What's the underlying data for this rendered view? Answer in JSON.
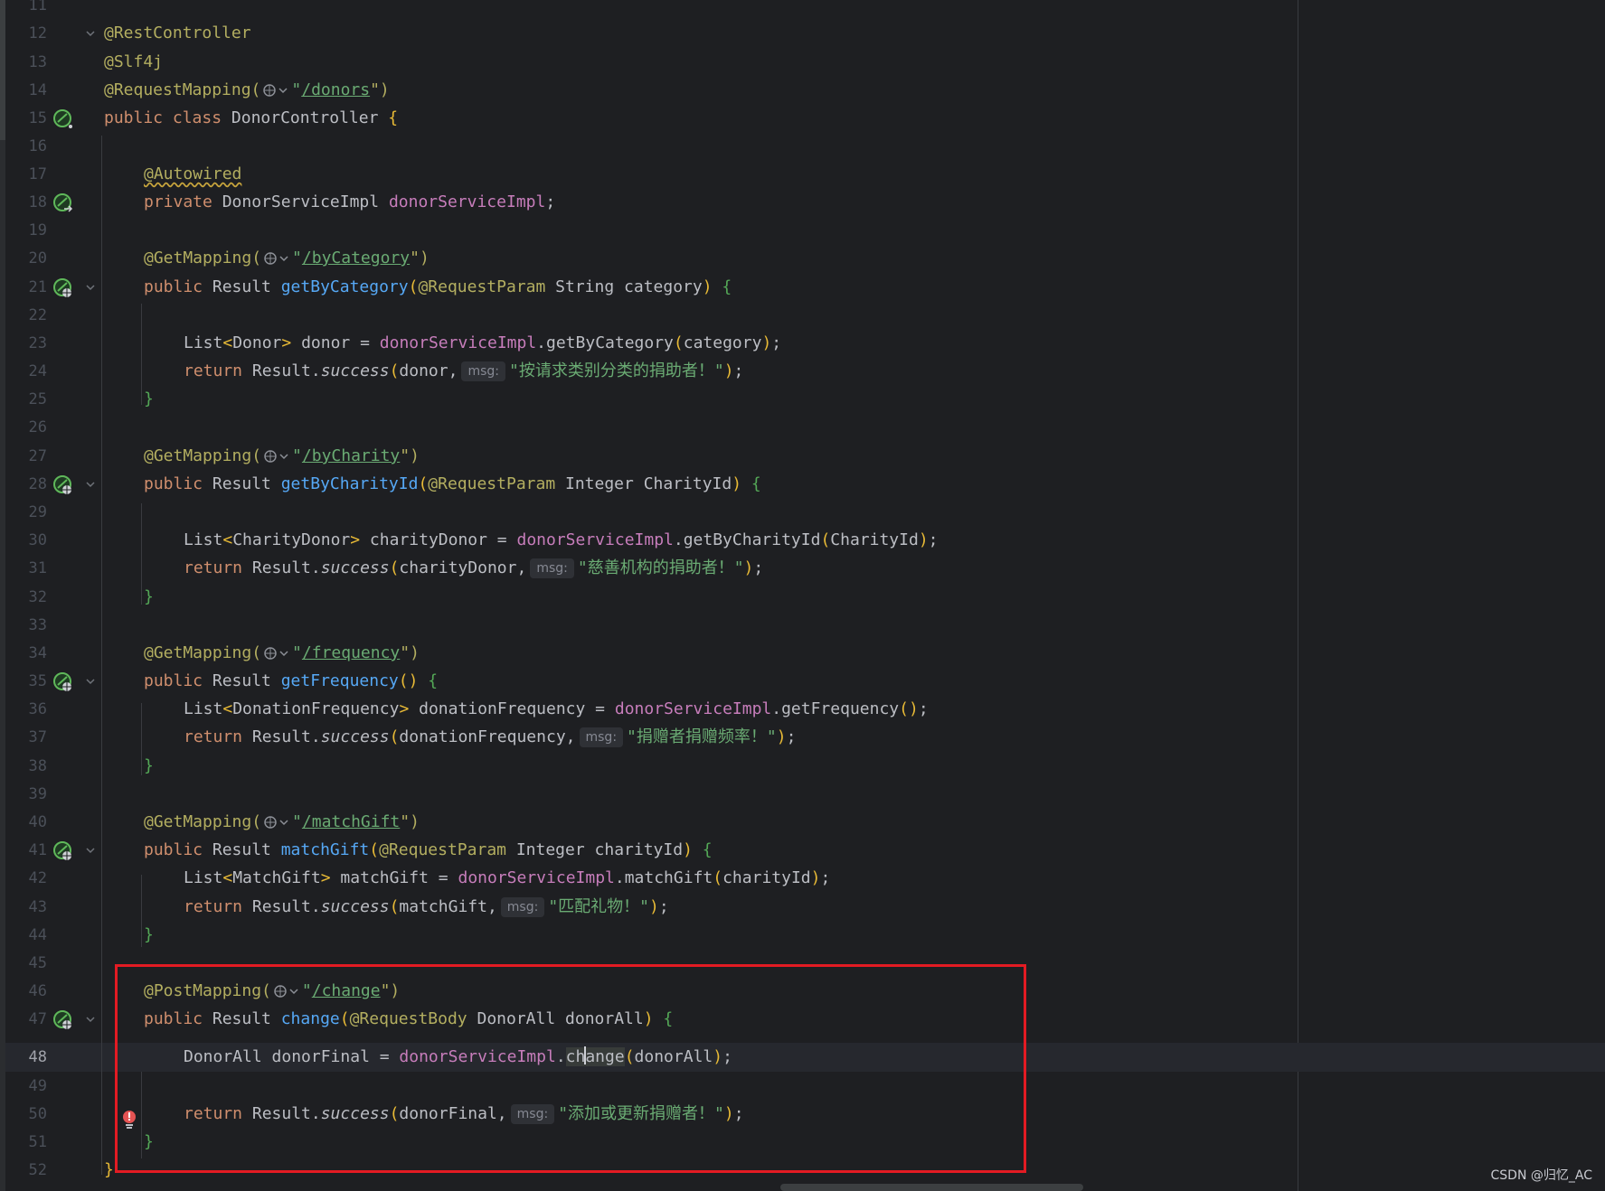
{
  "editor": {
    "language": "java",
    "current_line": 48,
    "lines": [
      {
        "n": "11"
      },
      {
        "n": "12",
        "code": {
          "t1": "@RestController"
        }
      },
      {
        "n": "13",
        "code": {
          "t1": "@Slf4j"
        }
      },
      {
        "n": "14",
        "code": {
          "t1": "@RequestMapping(",
          "url": "/donors",
          "t2": "\")"
        }
      },
      {
        "n": "15",
        "code": {
          "kw": "public class ",
          "t1": "DonorController ",
          "b": "{"
        }
      },
      {
        "n": "16"
      },
      {
        "n": "17",
        "code": {
          "t1": "@Autowired"
        }
      },
      {
        "n": "18",
        "code": {
          "kw": "private ",
          "t1": "DonorServiceImpl ",
          "fld": "donorServiceImpl",
          "t2": ";"
        }
      },
      {
        "n": "19"
      },
      {
        "n": "20",
        "code": {
          "t1": "@GetMapping(",
          "url": "/byCategory",
          "t2": "\")"
        }
      },
      {
        "n": "21",
        "code": {
          "kw": "public ",
          "t1": "Result ",
          "fn": "getByCategory",
          "p": "(",
          "an": "@RequestParam ",
          "t2": "String category",
          "p2": ") ",
          "b": "{"
        }
      },
      {
        "n": "22"
      },
      {
        "n": "23",
        "code": {
          "t1": "List",
          "lt": "<",
          "t2": "Donor",
          "gt": ">",
          "t3": " donor = ",
          "fld": "donorServiceImpl",
          "t4": ".getByCategory",
          "p": "(",
          "t5": "category",
          "p2": ")",
          "t6": ";"
        }
      },
      {
        "n": "24",
        "code": {
          "kw": "return ",
          "t1": "Result.",
          "it": "success",
          "p": "(",
          "t2": "donor,",
          "hint": "msg:",
          "str": "\"按请求类别分类的捐助者！\"",
          "p2": ")",
          "t3": ";"
        }
      },
      {
        "n": "25",
        "code": {
          "b": "}"
        }
      },
      {
        "n": "26"
      },
      {
        "n": "27",
        "code": {
          "t1": "@GetMapping(",
          "url": "/byCharity",
          "t2": "\")"
        }
      },
      {
        "n": "28",
        "code": {
          "kw": "public ",
          "t1": "Result ",
          "fn": "getByCharityId",
          "p": "(",
          "an": "@RequestParam ",
          "t2": "Integer CharityId",
          "p2": ") ",
          "b": "{"
        }
      },
      {
        "n": "29"
      },
      {
        "n": "30",
        "code": {
          "t1": "List",
          "lt": "<",
          "t2": "CharityDonor",
          "gt": ">",
          "t3": " charityDonor = ",
          "fld": "donorServiceImpl",
          "t4": ".getByCharityId",
          "p": "(",
          "t5": "CharityId",
          "p2": ")",
          "t6": ";"
        }
      },
      {
        "n": "31",
        "code": {
          "kw": "return ",
          "t1": "Result.",
          "it": "success",
          "p": "(",
          "t2": "charityDonor,",
          "hint": "msg:",
          "str": "\"慈善机构的捐助者！\"",
          "p2": ")",
          "t3": ";"
        }
      },
      {
        "n": "32",
        "code": {
          "b": "}"
        }
      },
      {
        "n": "33"
      },
      {
        "n": "34",
        "code": {
          "t1": "@GetMapping(",
          "url": "/frequency",
          "t2": "\")"
        }
      },
      {
        "n": "35",
        "code": {
          "kw": "public ",
          "t1": "Result ",
          "fn": "getFrequency",
          "p": "()",
          "t2": " ",
          "b": "{"
        }
      },
      {
        "n": "36",
        "code": {
          "t1": "List",
          "lt": "<",
          "t2": "DonationFrequency",
          "gt": ">",
          "t3": " donationFrequency = ",
          "fld": "donorServiceImpl",
          "t4": ".getFrequency",
          "p": "()",
          "t6": ";"
        }
      },
      {
        "n": "37",
        "code": {
          "kw": "return ",
          "t1": "Result.",
          "it": "success",
          "p": "(",
          "t2": "donationFrequency,",
          "hint": "msg:",
          "str": "\"捐赠者捐赠频率！\"",
          "p2": ")",
          "t3": ";"
        }
      },
      {
        "n": "38",
        "code": {
          "b": "}"
        }
      },
      {
        "n": "39"
      },
      {
        "n": "40",
        "code": {
          "t1": "@GetMapping(",
          "url": "/matchGift",
          "t2": "\")"
        }
      },
      {
        "n": "41",
        "code": {
          "kw": "public ",
          "t1": "Result ",
          "fn": "matchGift",
          "p": "(",
          "an": "@RequestParam ",
          "t2": "Integer charityId",
          "p2": ") ",
          "b": "{"
        }
      },
      {
        "n": "42",
        "code": {
          "t1": "List",
          "lt": "<",
          "t2": "MatchGift",
          "gt": ">",
          "t3": " matchGift = ",
          "fld": "donorServiceImpl",
          "t4": ".matchGift",
          "p": "(",
          "t5": "charityId",
          "p2": ")",
          "t6": ";"
        }
      },
      {
        "n": "43",
        "code": {
          "kw": "return ",
          "t1": "Result.",
          "it": "success",
          "p": "(",
          "t2": "matchGift,",
          "hint": "msg:",
          "str": "\"匹配礼物！\"",
          "p2": ")",
          "t3": ";"
        }
      },
      {
        "n": "44",
        "code": {
          "b": "}"
        }
      },
      {
        "n": "45"
      },
      {
        "n": "46",
        "code": {
          "t1": "@PostMapping(",
          "url": "/change",
          "t2": "\")"
        }
      },
      {
        "n": "47",
        "code": {
          "kw": "public ",
          "t1": "Result ",
          "fn": "change",
          "p": "(",
          "an": "@RequestBody ",
          "t2": "DonorAll donorAll",
          "p2": ") ",
          "b": "{"
        }
      },
      {
        "n": "48",
        "code": {
          "t1": "DonorAll donorFinal = ",
          "fld": "donorServiceImpl",
          "t4": ".",
          "w1": "ch",
          "w2": "ange",
          "p": "(",
          "t5": "donorAll",
          "p2": ")",
          "t6": ";"
        }
      },
      {
        "n": "49"
      },
      {
        "n": "50",
        "code": {
          "kw": "return ",
          "t1": "Result.",
          "it": "success",
          "p": "(",
          "t2": "donorFinal,",
          "hint": "msg:",
          "str": "\"添加或更新捐赠者！\"",
          "p2": ")",
          "t3": ";"
        }
      },
      {
        "n": "51",
        "code": {
          "b": "}"
        }
      },
      {
        "n": "52",
        "code": {
          "b": "}"
        }
      }
    ]
  },
  "watermark": "CSDN @归忆_AC",
  "colors": {
    "background": "#1e1f22",
    "keyword": "#cf8e6d",
    "annotation": "#b3ae60",
    "string": "#6aab73",
    "method": "#56a8f5",
    "field": "#c77dbb",
    "highlight_box": "#e31b23"
  },
  "icons": [
    "spring-bean-icon",
    "autowired-link-icon",
    "web-endpoint-icon",
    "fold-chevron-icon",
    "globe-icon",
    "error-bulb-icon"
  ]
}
